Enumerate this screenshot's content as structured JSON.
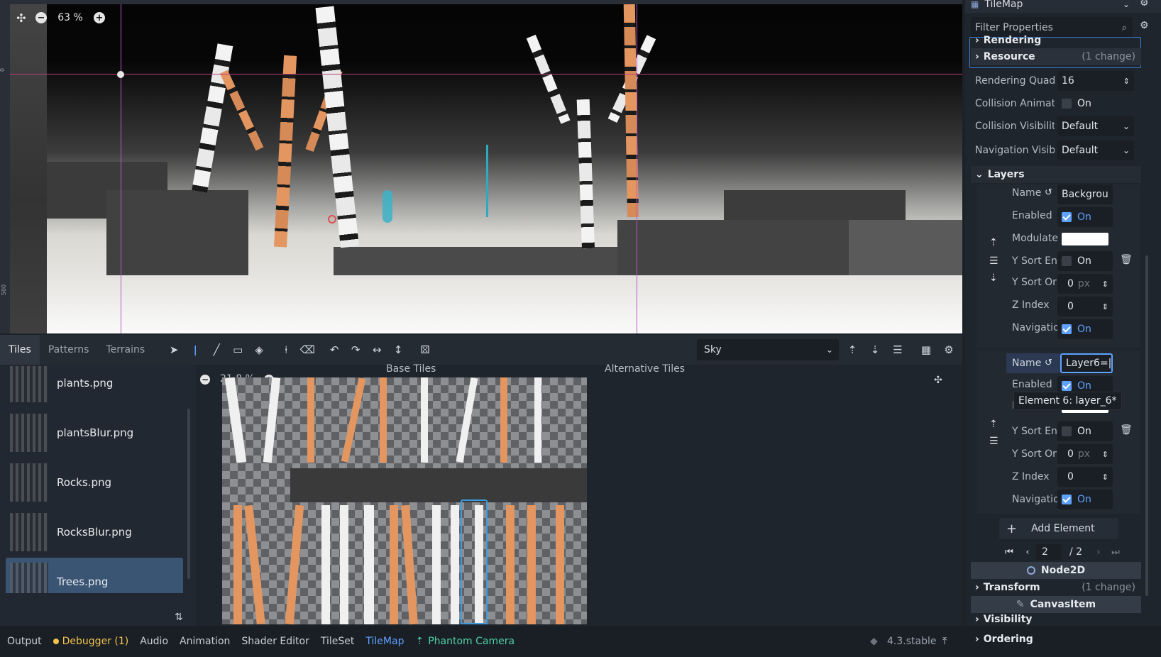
{
  "viewport": {
    "zoom": "63 %",
    "ruler_labels": [
      "0",
      "500"
    ]
  },
  "bottom_panel": {
    "tabs": [
      "Tiles",
      "Patterns",
      "Terrains"
    ],
    "active_tab": "Tiles",
    "layer_select": "Sky",
    "atlas_zoom": "21.8 %",
    "base_tiles_label": "Base Tiles",
    "alt_tiles_label": "Alternative Tiles",
    "files": [
      "plants.png",
      "plantsBlur.png",
      "Rocks.png",
      "RocksBlur.png",
      "Trees.png"
    ],
    "selected_file": "Trees.png"
  },
  "statusbar": {
    "items": [
      "Output",
      "Debugger (1)",
      "Audio",
      "Animation",
      "Shader Editor",
      "TileSet",
      "TileMap",
      "Phantom Camera"
    ],
    "version": "4.3.stable"
  },
  "inspector": {
    "node_type": "TileMap",
    "filter_placeholder": "Filter Properties",
    "rendering": "Rendering",
    "resource": "Resource",
    "resource_change": "(1 change)",
    "rendering_quad_label": "Rendering Quad",
    "rendering_quad_value": "16",
    "collision_anim_label": "Collision Animat",
    "collision_vis_label": "Collision Visibilit",
    "collision_vis_value": "Default",
    "navigation_vis_label": "Navigation Visib",
    "navigation_vis_value": "Default",
    "on": "On",
    "layers_label": "Layers",
    "layer1": {
      "name_label": "Name",
      "name_value": "Backgrou",
      "enabled_label": "Enabled",
      "modulate_label": "Modulate",
      "ysort_en_label": "Y Sort En",
      "ysort_ori_label": "Y Sort Ori",
      "ysort_ori_value": "0",
      "px": "px",
      "zindex_label": "Z Index",
      "zindex_value": "0",
      "navigation_label": "Navigatio"
    },
    "layer2": {
      "name_value": "Layer6=|",
      "tooltip": "Element 6: layer_6*"
    },
    "add_element": "Add Element",
    "page_current": "2",
    "page_total": "/ 2",
    "node2d": "Node2D",
    "transform": "Transform",
    "transform_change": "(1 change)",
    "canvasitem": "CanvasItem",
    "visibility": "Visibility",
    "ordering": "Ordering"
  }
}
